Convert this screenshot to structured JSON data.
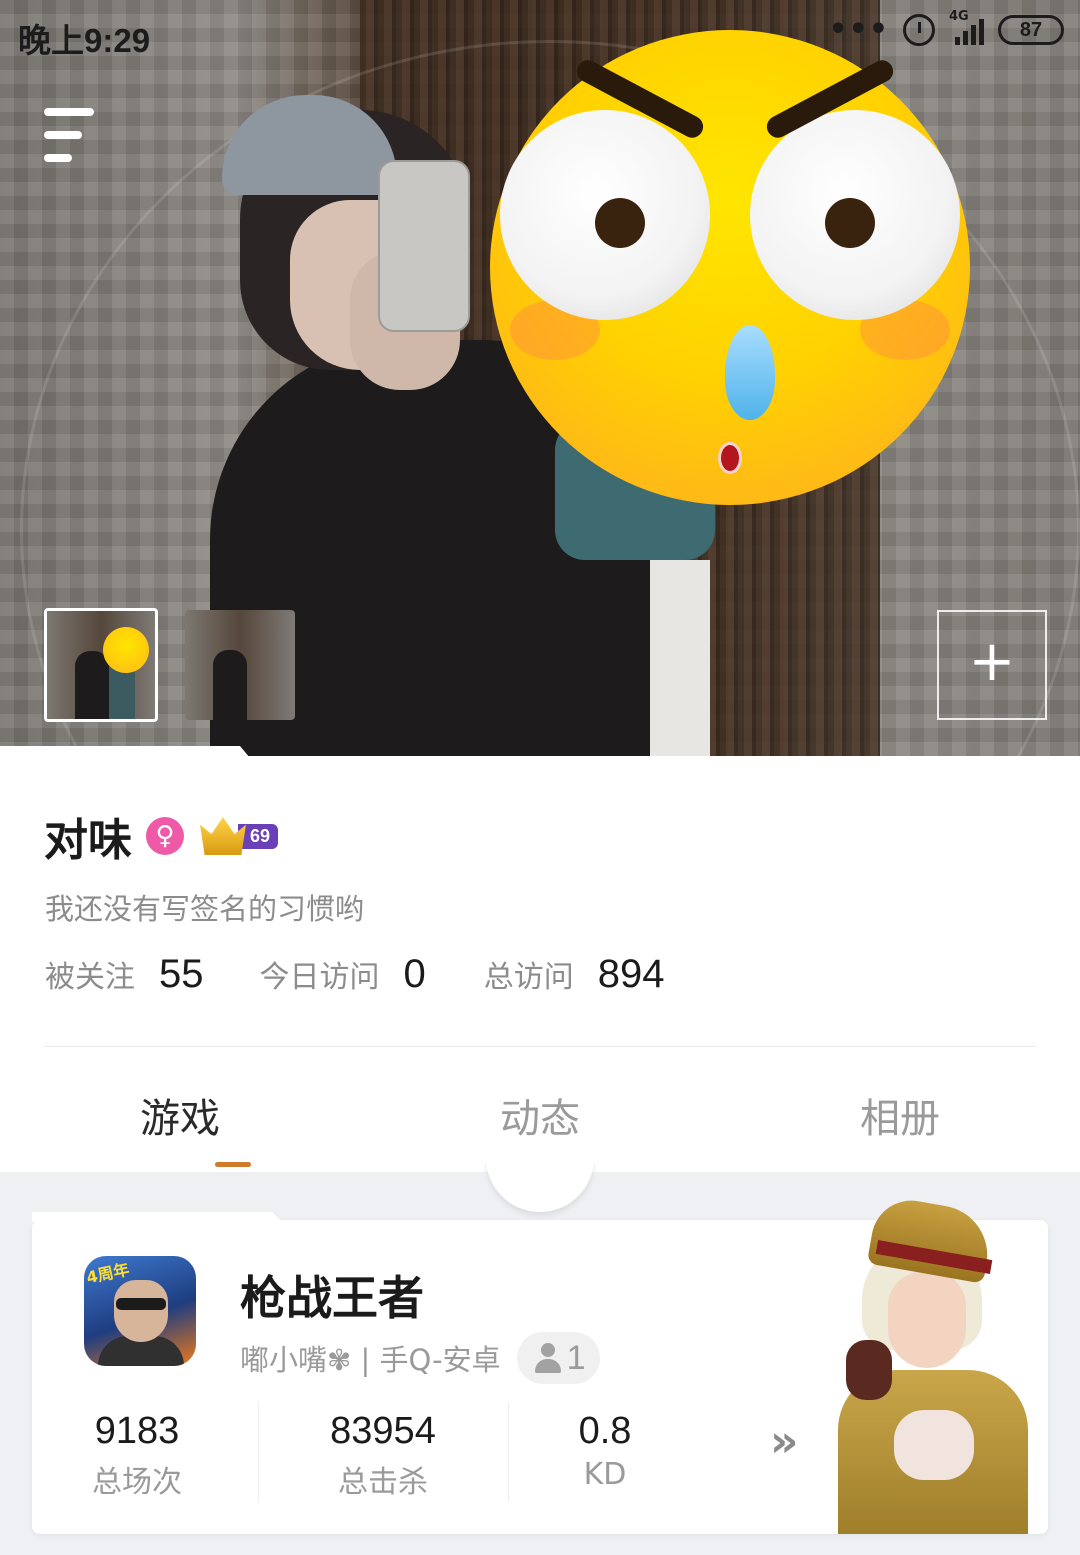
{
  "status_bar": {
    "time": "晚上9:29",
    "network": "4G",
    "battery": "87"
  },
  "hero": {
    "add_photo_symbol": "+"
  },
  "profile": {
    "name": "对味",
    "gender_symbol": "♀",
    "level": "69",
    "signature": "我还没有写签名的习惯哟",
    "stats": {
      "followers_label": "被关注",
      "followers": "55",
      "today_visits_label": "今日访问",
      "today_visits": "0",
      "total_visits_label": "总访问",
      "total_visits": "894"
    }
  },
  "tabs": {
    "games": "游戏",
    "feed": "动态",
    "album": "相册",
    "active": "games"
  },
  "game_card": {
    "icon_tag": "4周年",
    "title": "枪战王者",
    "account": "嘟小嘴✾ | 手Q-安卓",
    "friends_count": "1",
    "stats": [
      {
        "value": "9183",
        "label": "总场次"
      },
      {
        "value": "83954",
        "label": "总击杀"
      },
      {
        "value": "0.8",
        "label": "KD"
      }
    ],
    "more_symbol": "»"
  },
  "colors": {
    "tab_underline": "#d07a2d",
    "gender_badge": "#ef5aa8",
    "level_badge": "#6a3fb8"
  }
}
